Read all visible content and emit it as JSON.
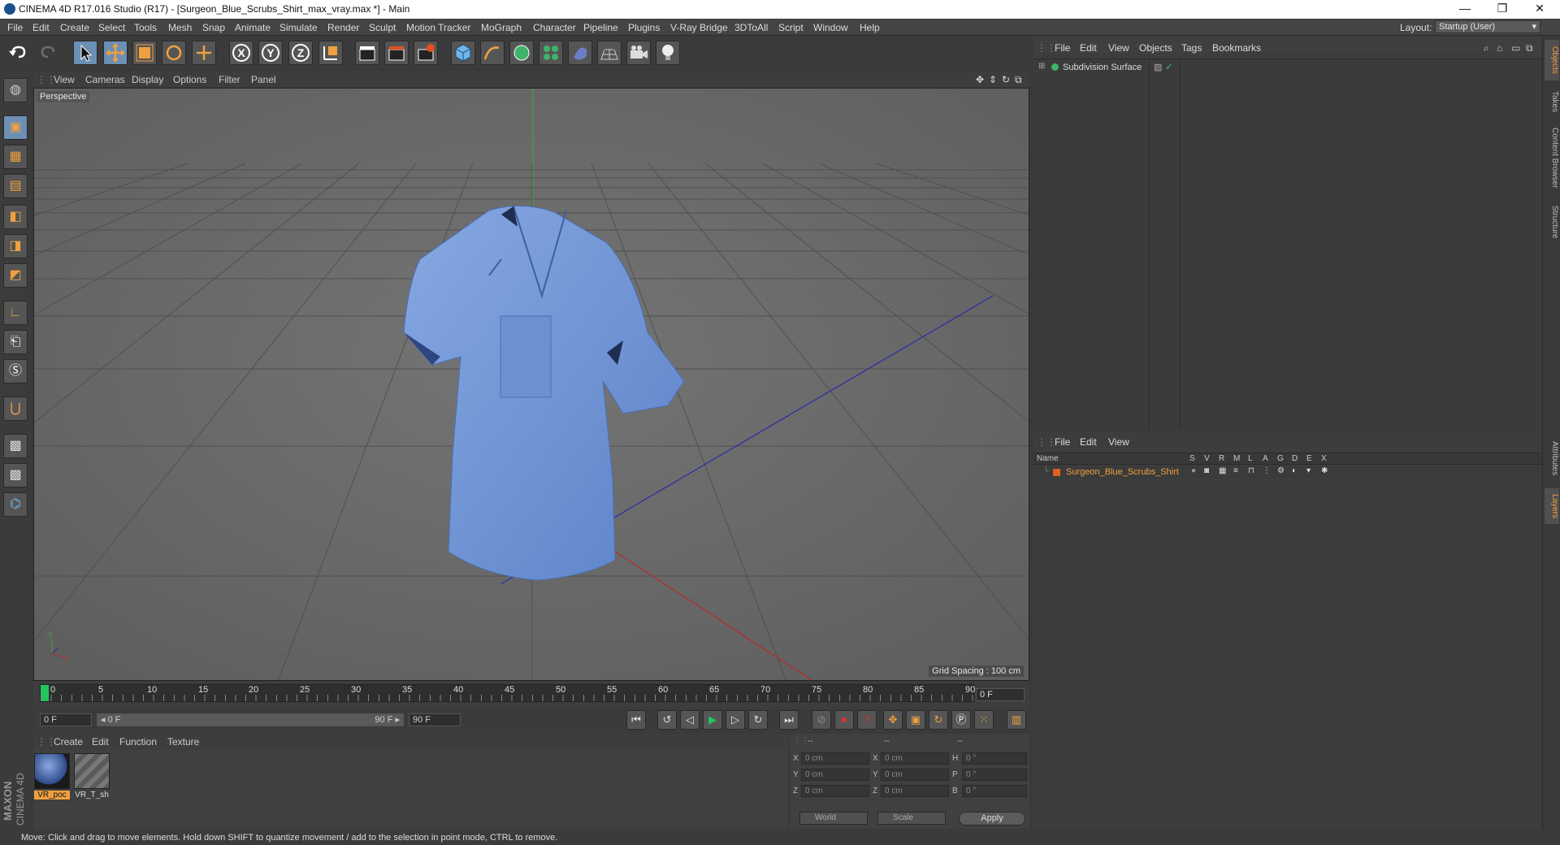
{
  "window": {
    "title": "CINEMA 4D R17.016 Studio (R17) - [Surgeon_Blue_Scrubs_Shirt_max_vray.max *] - Main",
    "minimize": "—",
    "maximize": "❐",
    "close": "✕"
  },
  "menu": {
    "items": [
      "File",
      "Edit",
      "Create",
      "Select",
      "Tools",
      "Mesh",
      "Snap",
      "Animate",
      "Simulate",
      "Render",
      "Sculpt",
      "Motion Tracker",
      "MoGraph",
      "Character",
      "Pipeline",
      "Plugins",
      "V-Ray Bridge",
      "3DToAll",
      "Script",
      "Window",
      "Help"
    ],
    "layout_label": "Layout:",
    "layout_value": "Startup (User)"
  },
  "toolbar": {
    "axis_x": "X",
    "axis_y": "Y",
    "axis_z": "Z"
  },
  "viewport": {
    "menu": [
      "View",
      "Cameras",
      "Display",
      "Options",
      "Filter",
      "Panel"
    ],
    "camera_label": "Perspective",
    "grid_spacing": "Grid Spacing : 100 cm"
  },
  "timeline": {
    "ticks": [
      "0",
      "5",
      "10",
      "15",
      "20",
      "25",
      "30",
      "35",
      "40",
      "45",
      "50",
      "55",
      "60",
      "65",
      "70",
      "75",
      "80",
      "85",
      "90"
    ],
    "current_frame": "0 F",
    "start_field": "0 F",
    "range_start": "◂ 0 F",
    "range_end": "90 F ▸",
    "end_field": "90 F"
  },
  "materials": {
    "menu": [
      "Create",
      "Edit",
      "Function",
      "Texture"
    ],
    "items": [
      {
        "label": "VR_poc"
      },
      {
        "label": "VR_T_sh"
      }
    ]
  },
  "coords": {
    "header": [
      "--",
      "--",
      "--"
    ],
    "rows": [
      {
        "l1": "X",
        "v1": "0 cm",
        "l2": "X",
        "v2": "0 cm",
        "l3": "H",
        "v3": "0 °"
      },
      {
        "l1": "Y",
        "v1": "0 cm",
        "l2": "Y",
        "v2": "0 cm",
        "l3": "P",
        "v3": "0 °"
      },
      {
        "l1": "Z",
        "v1": "0 cm",
        "l2": "Z",
        "v2": "0 cm",
        "l3": "B",
        "v3": "0 °"
      }
    ],
    "mode_world": "World",
    "mode_scale": "Scale",
    "apply": "Apply"
  },
  "status": {
    "text": "Move: Click and drag to move elements. Hold down SHIFT to quantize movement / add to the selection in point mode, CTRL to remove."
  },
  "brand": {
    "maxon": "MAXON",
    "product": "CINEMA 4D"
  },
  "objects_panel": {
    "menu": [
      "File",
      "Edit",
      "View",
      "Objects",
      "Tags",
      "Bookmarks"
    ],
    "object_name": "Subdivision Surface"
  },
  "layers_panel": {
    "menu": [
      "File",
      "Edit",
      "View"
    ],
    "columns": [
      "Name",
      "S",
      "V",
      "R",
      "M",
      "L",
      "A",
      "G",
      "D",
      "E",
      "X"
    ],
    "layer_name": "Surgeon_Blue_Scrubs_Shirt"
  },
  "side_tabs": [
    "Objects",
    "Takes",
    "Content Browser",
    "Structure",
    "Attributes",
    "Layers"
  ],
  "colors": {
    "accent_orange": "#f0a040",
    "shirt_blue": "#6f94d4",
    "selected_tool": "#6c8fb5"
  }
}
